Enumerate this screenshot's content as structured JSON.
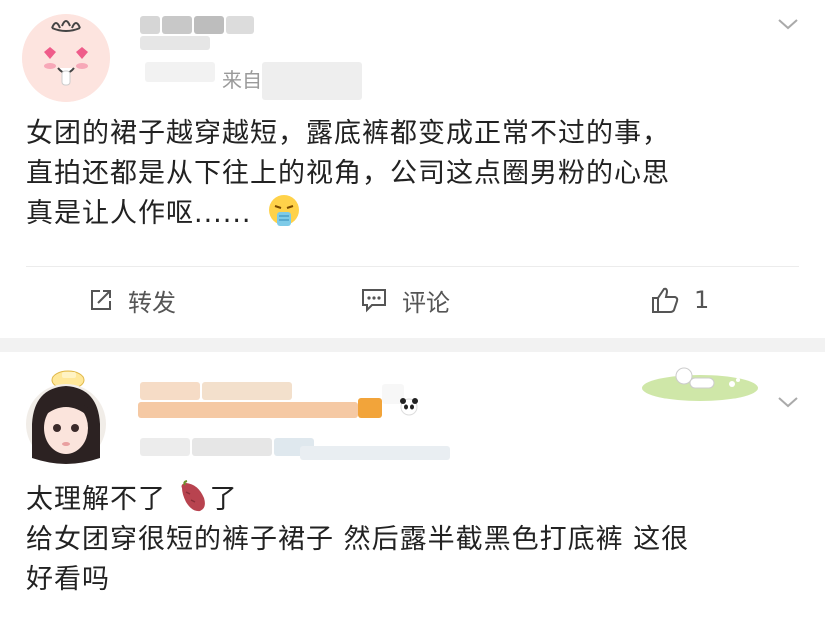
{
  "post1": {
    "source_prefix": "来自",
    "text_lines": [
      "女团的裙子越穿越短，露底裤都变成正常不过的事，",
      "直拍还都是从下往上的视角，公司这点圈男粉的心思",
      "真是让人作呕......"
    ],
    "actions": {
      "repost_label": "转发",
      "comment_label": "评论",
      "like_count": "1"
    }
  },
  "post2": {
    "text_lines": [
      "太理解不了",
      "了",
      "给女团穿很短的裤子裙子 然后露半截黑色打底裤 这很",
      "好看吗"
    ]
  },
  "icons": [
    "retching-emoji-icon",
    "sweet-potato-icon",
    "repost-icon",
    "comment-icon",
    "thumbs-up-icon",
    "chevron-down-icon"
  ]
}
